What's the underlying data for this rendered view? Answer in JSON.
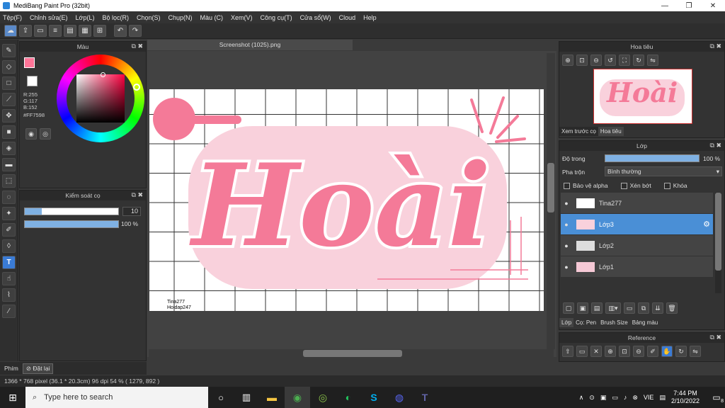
{
  "window": {
    "title": "MediBang Paint Pro (32bit)",
    "controls": [
      "—",
      "❐",
      "✕"
    ]
  },
  "menu": [
    "Tệp(F)",
    "Chỉnh sửa(E)",
    "Lớp(L)",
    "Bộ lọc(R)",
    "Chọn(S)",
    "Chụp(N)",
    "Màu (C)",
    "Xem(V)",
    "Công cụ(T)",
    "Cửa sổ(W)",
    "Cloud",
    "Help"
  ],
  "color_panel": {
    "title": "Màu",
    "r": "R:255",
    "g": "G:117",
    "b": "B:152",
    "hex": "#FF7598",
    "primary": "#FF7598",
    "secondary": "#ffffff"
  },
  "brush_panel": {
    "title": "Kiểm soát cọ",
    "size_value": "10",
    "size_fraction": 0.18,
    "opacity_value": "100 %",
    "opacity_fraction": 1.0,
    "bottom_tabs": [
      "Phím",
      "Đặt lại"
    ]
  },
  "document": {
    "tab_title": "Screenshot (1025).png",
    "hoai_text": "Hoài",
    "watermark_line1": "Tina277",
    "watermark_line2": "Hoidap247",
    "accent": "#f47a98",
    "light_accent": "#f9d1dc"
  },
  "navigator": {
    "title": "Hoa tiêu",
    "tabs": [
      "Xem trước cọ",
      "Hoa tiêu"
    ]
  },
  "layers": {
    "title": "Lớp",
    "opacity_label": "Độ trong",
    "opacity_value": "100 %",
    "blend_label": "Pha trộn",
    "blend_value": "Bình thường",
    "checks": [
      "Bảo vệ alpha",
      "Xén bớt",
      "Khóa"
    ],
    "items": [
      {
        "name": "Tina277",
        "selected": false
      },
      {
        "name": "Lớp3",
        "selected": true
      },
      {
        "name": "Lớp2",
        "selected": false
      },
      {
        "name": "Lớp1",
        "selected": false
      }
    ],
    "bottom_tabs": [
      "Lớp",
      "Cọ: Pen",
      "Brush Size",
      "Bảng màu"
    ]
  },
  "reference": {
    "title": "Reference"
  },
  "status": {
    "text": "1366 * 768 pixel  (36.1 * 20.3cm)  96 dpi  54 %  ( 1279, 892 )"
  },
  "taskbar": {
    "search_placeholder": "Type here to search",
    "lang": "VIE",
    "time": "7:44 PM",
    "date": "2/10/2022",
    "notification_count": "8"
  }
}
